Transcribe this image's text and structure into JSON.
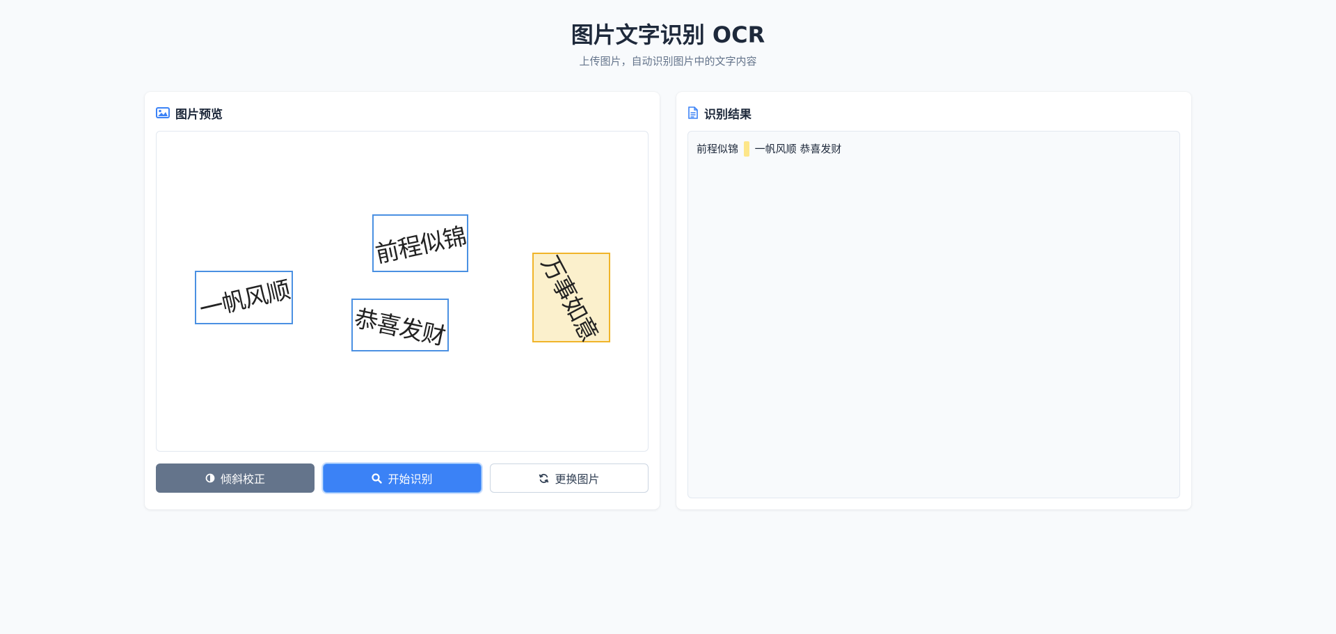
{
  "header": {
    "title": "图片文字识别 OCR",
    "subtitle": "上传图片，自动识别图片中的文字内容"
  },
  "preview_panel": {
    "title": "图片预览",
    "icon": "image-icon",
    "boxes": [
      {
        "text": "前程似锦",
        "highlighted": false
      },
      {
        "text": "一帆风顺",
        "highlighted": false
      },
      {
        "text": "恭喜发财",
        "highlighted": false
      },
      {
        "text": "万事如意",
        "highlighted": true
      }
    ]
  },
  "actions": {
    "deskew": {
      "label": "倾斜校正",
      "icon": "contrast-icon"
    },
    "recognize": {
      "label": "开始识别",
      "icon": "search-icon"
    },
    "replace": {
      "label": "更换图片",
      "icon": "refresh-icon"
    }
  },
  "result_panel": {
    "title": "识别结果",
    "icon": "document-icon",
    "segments": [
      "前程似锦",
      "一帆风顺",
      "恭喜发财"
    ]
  },
  "colors": {
    "accent": "#3b82f6",
    "box_border": "#4a90e2",
    "highlight_border": "#f0b429",
    "highlight_fill": "#fbf0cc",
    "result_highlight": "#fde68a"
  }
}
